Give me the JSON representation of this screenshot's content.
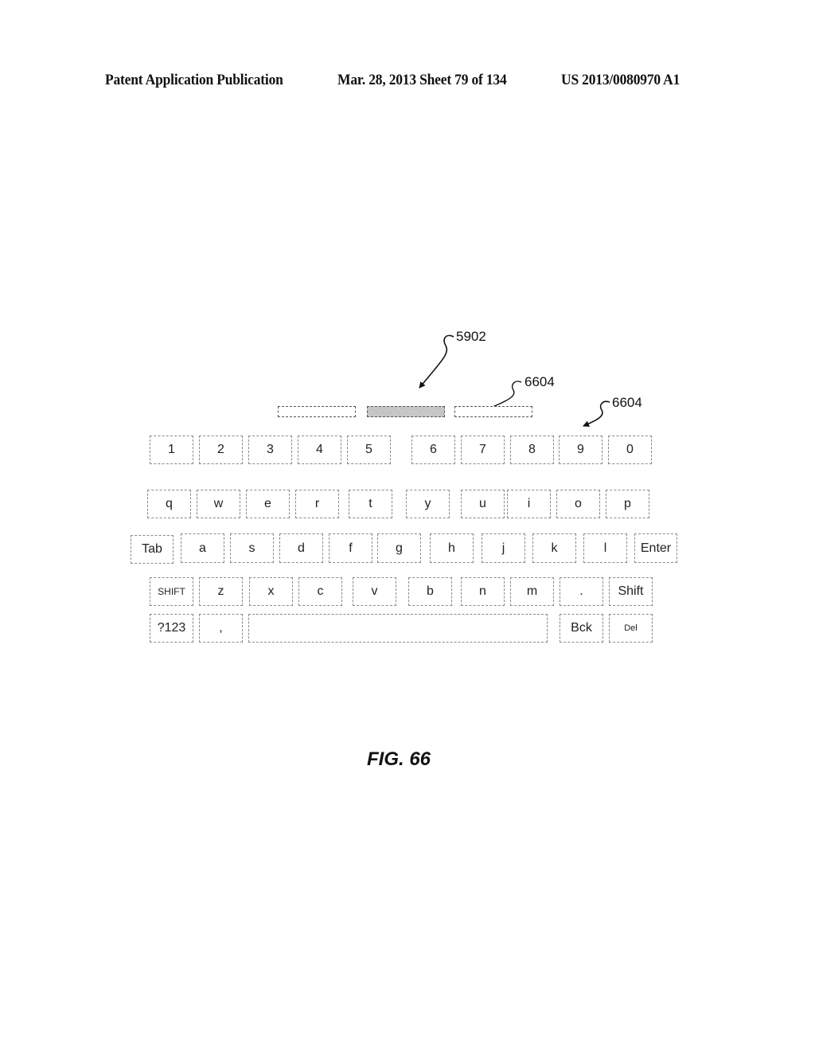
{
  "header": {
    "left": "Patent Application Publication",
    "middle": "Mar. 28, 2013  Sheet 79 of 134",
    "right": "US 2013/0080970 A1"
  },
  "suggestion_bars": [
    {
      "name": "suggestion-bar-1",
      "state": "normal"
    },
    {
      "name": "suggestion-bar-2",
      "state": "selected"
    },
    {
      "name": "suggestion-bar-3",
      "state": "normal"
    }
  ],
  "reference_labels": {
    "label_5902": "5902",
    "label_6604_bar": "6604",
    "label_6604_key": "6604"
  },
  "keyboard": {
    "row1": [
      "1",
      "2",
      "3",
      "4",
      "5",
      "6",
      "7",
      "8",
      "9",
      "0"
    ],
    "row2": [
      "q",
      "w",
      "e",
      "r",
      "t",
      "y",
      "u",
      "i",
      "o",
      "p"
    ],
    "row3": [
      "Tab",
      "a",
      "s",
      "d",
      "f",
      "g",
      "h",
      "j",
      "k",
      "l",
      "Enter"
    ],
    "row4": [
      "SHIFT",
      "z",
      "x",
      "c",
      "v",
      "b",
      "n",
      "m",
      ".",
      "Shift"
    ],
    "row5": [
      "?123",
      ",",
      "",
      "Bck",
      "Del"
    ]
  },
  "figure_caption": "FIG. 66"
}
